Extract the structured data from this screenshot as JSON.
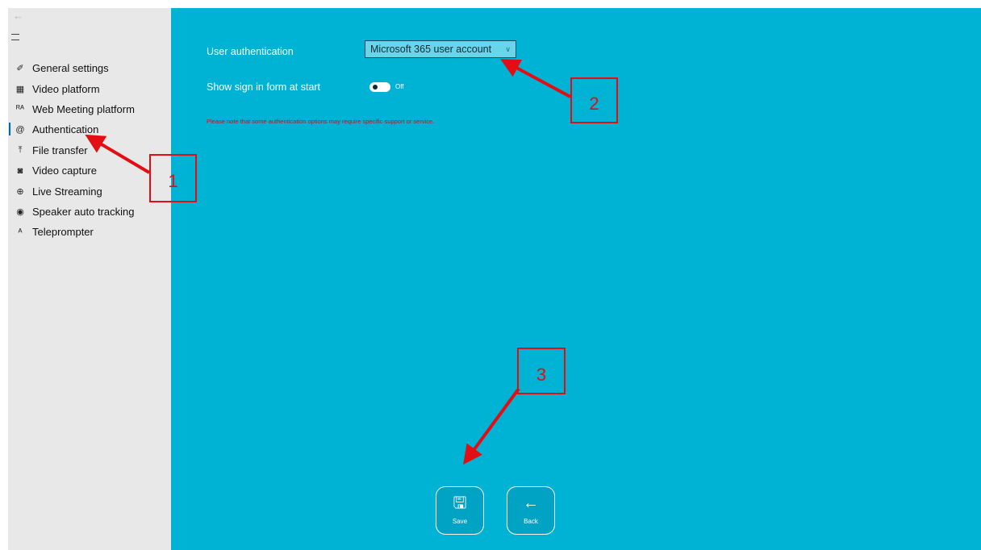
{
  "sidebar": {
    "back_glyph": "←",
    "hamburger_icon": "hamburger-icon",
    "items": [
      {
        "label": "General settings",
        "icon": "✐",
        "icon_name": "wrench-icon"
      },
      {
        "label": "Video platform",
        "icon": "▦",
        "icon_name": "video-platform-icon"
      },
      {
        "label": "Web Meeting platform",
        "icon": "ᴿᴬ",
        "icon_name": "web-meeting-icon"
      },
      {
        "label": "Authentication",
        "icon": "@",
        "icon_name": "at-icon",
        "selected": true
      },
      {
        "label": "File transfer",
        "icon": "⤒",
        "icon_name": "upload-icon"
      },
      {
        "label": "Video capture",
        "icon": "◙",
        "icon_name": "camera-icon"
      },
      {
        "label": "Live Streaming",
        "icon": "⊕",
        "icon_name": "globe-icon"
      },
      {
        "label": "Speaker auto tracking",
        "icon": "◉",
        "icon_name": "tracking-icon"
      },
      {
        "label": "Teleprompter",
        "icon": "ᴬ",
        "icon_name": "teleprompter-icon"
      }
    ]
  },
  "settings": {
    "user_auth_label": "User authentication",
    "user_auth_value": "Microsoft 365 user account",
    "chevron": "∨",
    "show_signin_label": "Show sign in form at start",
    "show_signin_state": "Off",
    "show_signin_on": false,
    "note": "Please note that some authentication options may require specific support or service."
  },
  "actions": {
    "save_label": "Save",
    "save_icon": "🖫",
    "back_label": "Back",
    "back_icon": "←"
  },
  "annotations": {
    "marker_1": "1",
    "marker_2": "2",
    "marker_3": "3",
    "color": "#e30e14"
  },
  "colors": {
    "content_bg": "#00b2d3",
    "sidebar_bg": "#e8e8e8",
    "note_text": "#c8101e",
    "selection_accent": "#0067c0"
  }
}
